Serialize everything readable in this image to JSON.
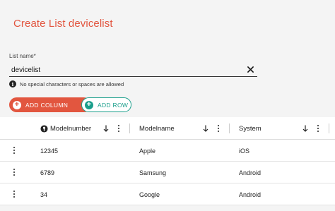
{
  "header": {
    "title": "Create List devicelist"
  },
  "list_name": {
    "label": "List name*",
    "value": "devicelist",
    "hint": "No special characters or spaces are allowed"
  },
  "actions": {
    "add_column": "ADD COLUMN",
    "add_row": "ADD ROW"
  },
  "colors": {
    "accent": "#e2563f",
    "secondary": "#1a9e8b"
  },
  "table": {
    "columns": [
      {
        "label": "Modelnumber",
        "key_icon": "key-icon"
      },
      {
        "label": "Modelname"
      },
      {
        "label": "System"
      }
    ],
    "rows": [
      [
        "12345",
        "Apple",
        "iOS"
      ],
      [
        "6789",
        "Samsung",
        "Android"
      ],
      [
        "34",
        "Google",
        "Android"
      ]
    ]
  }
}
